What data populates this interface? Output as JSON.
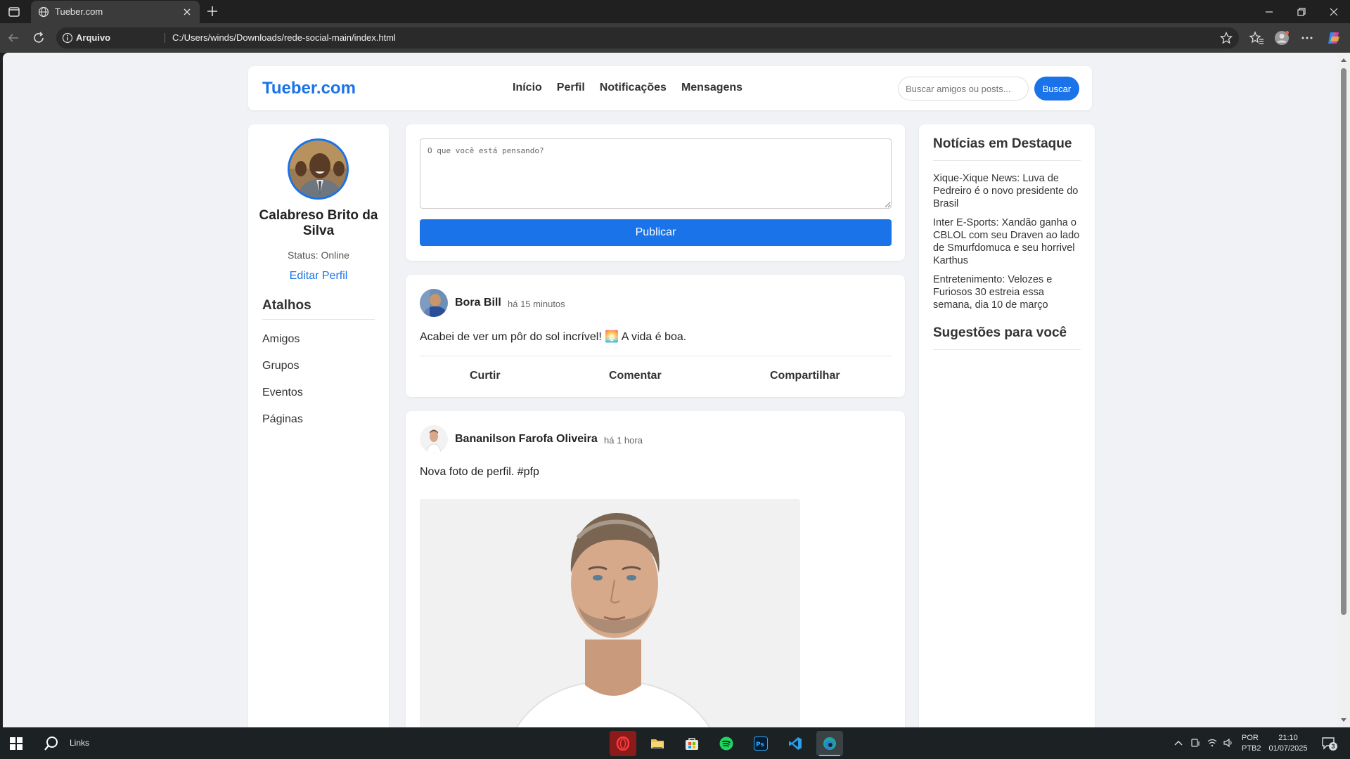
{
  "browser": {
    "tab_title": "Tueber.com",
    "address_label": "Arquivo",
    "url": "C:/Users/winds/Downloads/rede-social-main/index.html"
  },
  "header": {
    "logo": "Tueber.com",
    "nav": [
      "Início",
      "Perfil",
      "Notificações",
      "Mensagens"
    ],
    "search_placeholder": "Buscar amigos ou posts...",
    "search_button": "Buscar"
  },
  "profile": {
    "name": "Calabreso Brito da Silva",
    "status": "Status: Online",
    "edit_link": "Editar Perfil",
    "shortcuts_title": "Atalhos",
    "shortcuts": [
      "Amigos",
      "Grupos",
      "Eventos",
      "Páginas"
    ]
  },
  "composer": {
    "placeholder": "O que você está pensando?",
    "publish": "Publicar"
  },
  "posts": [
    {
      "author": "Bora Bill",
      "time": "há 15 minutos",
      "text": "Acabei de ver um pôr do sol incrível! 🌅 A vida é boa.",
      "actions": [
        "Curtir",
        "Comentar",
        "Compartilhar"
      ]
    },
    {
      "author": "Bananilson Farofa Oliveira",
      "time": "há 1 hora",
      "text": "Nova foto de perfil. #pfp"
    }
  ],
  "sidebar_right": {
    "news_title": "Notícias em Destaque",
    "news": [
      "Xique-Xique News: Luva de Pedreiro é o novo presidente do Brasil",
      "Inter E-Sports: Xandão ganha o CBLOL com seu Draven ao lado de Smurfdomuca e seu horrivel Karthus",
      "Entretenimento: Velozes e Furiosos 30 estreia essa semana, dia 10 de março"
    ],
    "suggestions_title": "Sugestões para você"
  },
  "taskbar": {
    "links_label": "Links",
    "lang_line1": "POR",
    "lang_line2": "PTB2",
    "time": "21:10",
    "date": "01/07/2025",
    "notification_count": "3"
  },
  "colors": {
    "accent": "#1a73e8",
    "page_bg": "#f0f2f5"
  }
}
